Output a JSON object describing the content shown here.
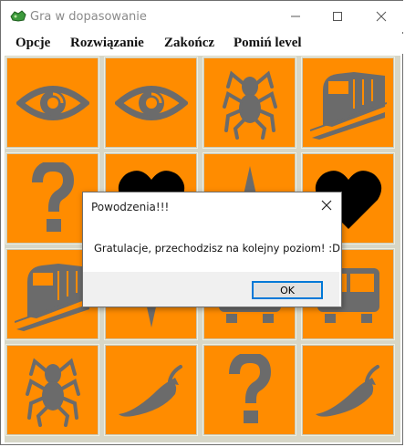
{
  "window": {
    "title": "Gra w dopasowanie"
  },
  "menu": {
    "items": [
      "Opcje",
      "Rozwiązanie",
      "Zakończ",
      "Pomiń level"
    ]
  },
  "colors": {
    "tile": "#ff8c00",
    "icon": "#6b6b6b",
    "heart": "#000000"
  },
  "grid": {
    "rows": [
      [
        "eye-icon",
        "eye-icon",
        "spider-icon",
        "train-icon"
      ],
      [
        "question-mark-icon",
        "heart-icon",
        "compass-icon",
        "heart-icon"
      ],
      [
        "train-icon",
        "compass-icon",
        "bus-icon",
        "bus-icon"
      ],
      [
        "spider-icon",
        "chili-pepper-icon",
        "question-mark-icon",
        "chili-pepper-icon"
      ]
    ]
  },
  "dialog": {
    "title": "Powodzenia!!!",
    "message": "Gratulacje, przechodzisz na kolejny poziom! :D",
    "ok_label": "OK"
  }
}
